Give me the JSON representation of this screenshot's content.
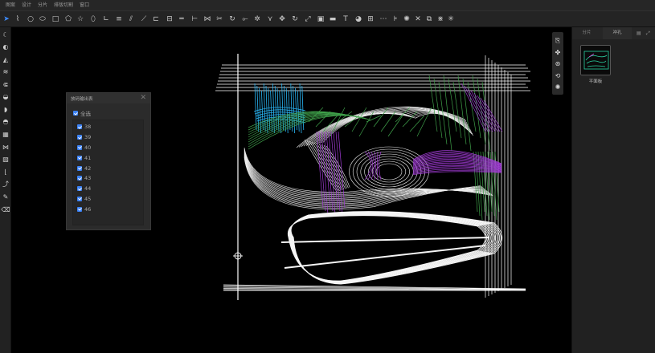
{
  "menu": [
    "图案",
    "设计",
    "分片",
    "排版切割",
    "窗口"
  ],
  "toolbar": {
    "icons": [
      "pointer-icon",
      "bezier-pen-icon",
      "circle-icon",
      "ellipse-icon",
      "rectangle-icon",
      "polygon-icon",
      "star-icon",
      "oval-icon",
      "angle-tool-icon",
      "parallel-lines-icon",
      "offset-line-icon",
      "mirror-line-icon",
      "align-icon",
      "distribute-icon",
      "spacing-icon",
      "split-icon",
      "join-icon",
      "cut-icon",
      "trim-icon",
      "move-icon",
      "rotate-icon",
      "scale-icon",
      "frame-icon",
      "fill-icon",
      "text-icon",
      "color-icon",
      "grid-icon",
      "node-icon",
      "measure-icon",
      "transform-icon",
      "flip-icon",
      "snap-icon",
      "settings-icon"
    ]
  },
  "left_tools": [
    "shoe-last-icon",
    "toe-cap-icon",
    "heel-icon",
    "vamp-icon",
    "quarter-icon",
    "sole-icon",
    "tongue-icon",
    "collar-icon",
    "lining-icon",
    "eyelet-icon",
    "grade-icon",
    "seam-icon",
    "notch-icon",
    "pencil-icon",
    "eraser-icon"
  ],
  "float_tools": [
    "import-icon",
    "layers-icon",
    "measure-point-icon",
    "sync-icon",
    "export-icon"
  ],
  "dialog": {
    "title": "放码输出表",
    "select_all": "全选",
    "sizes": [
      "38",
      "39",
      "40",
      "41",
      "42",
      "43",
      "44",
      "45",
      "46"
    ]
  },
  "right_panel": {
    "tabs": [
      "分片",
      "冲孔"
    ],
    "thumbnail_label": "平面板"
  },
  "colors": {
    "accent": "#3b82f6",
    "lines": "#ffffff",
    "cyan": "#29b6f6",
    "green": "#3fa04a",
    "purple": "#a23bd6"
  }
}
